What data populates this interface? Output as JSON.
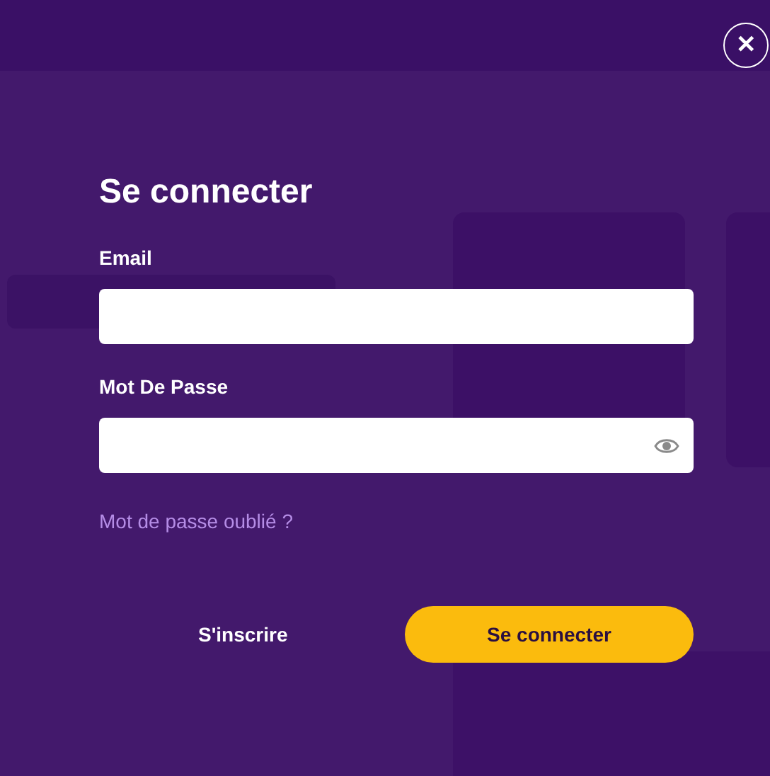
{
  "dialog": {
    "title": "Se connecter",
    "fields": [
      {
        "label": "Email",
        "kind": "text"
      },
      {
        "label": "Mot De Passe",
        "kind": "password"
      }
    ],
    "forgot_link": "Mot de passe oublié ?",
    "register_link": "S'inscrire",
    "submit_button": "Se connecter",
    "close_button": "✕"
  }
}
